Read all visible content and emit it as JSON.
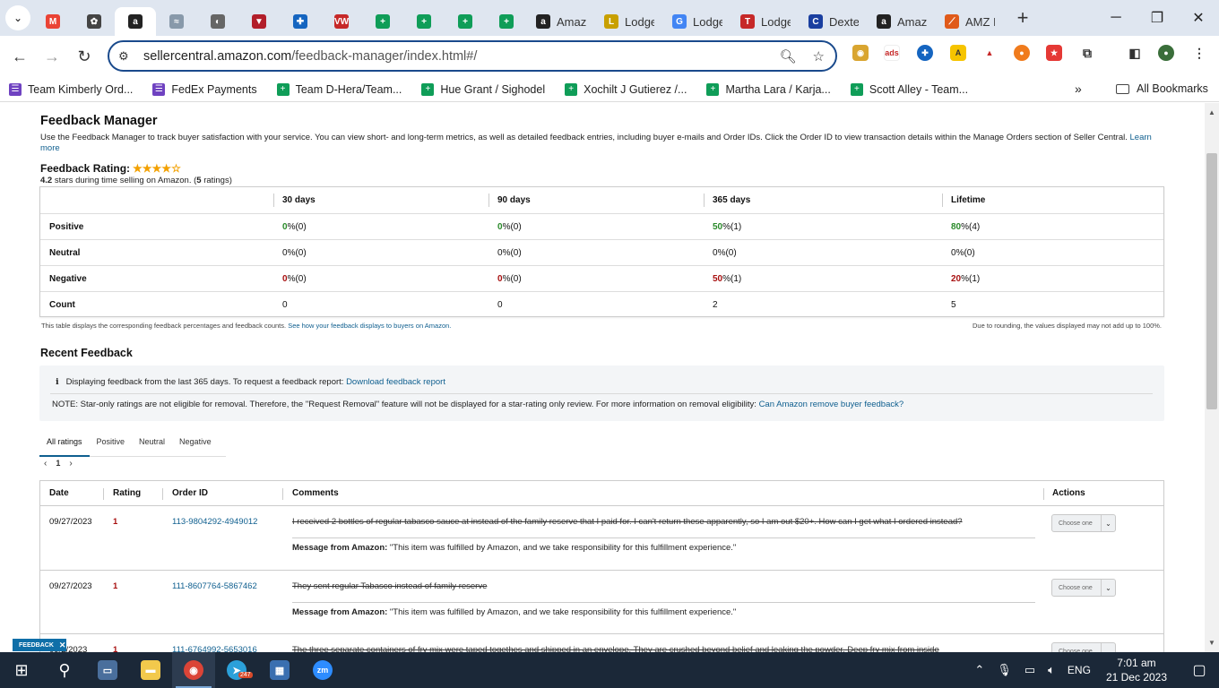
{
  "browser": {
    "tabs": [
      {
        "icon": "gmail-icon",
        "label": "",
        "color": "#ea4335",
        "glyph": "M"
      },
      {
        "icon": "chatgpt-icon",
        "label": "",
        "color": "#444444",
        "glyph": "✿"
      },
      {
        "icon": "amazon-icon",
        "label": "",
        "color": "#222222",
        "glyph": "a",
        "active": true
      },
      {
        "icon": "app-icon",
        "label": "",
        "color": "#8899aa",
        "glyph": "≈"
      },
      {
        "icon": "globe-icon",
        "label": "",
        "color": "#666666",
        "glyph": "◐"
      },
      {
        "icon": "shield-icon",
        "label": "",
        "color": "#b21e2a",
        "glyph": "▼"
      },
      {
        "icon": "compass-icon",
        "label": "",
        "color": "#1565c0",
        "glyph": "✚"
      },
      {
        "icon": "vw-icon",
        "label": "",
        "color": "#c62828",
        "glyph": "VW"
      },
      {
        "icon": "sheets-icon",
        "label": "",
        "color": "#0f9d58",
        "glyph": "+"
      },
      {
        "icon": "sheets-icon",
        "label": "",
        "color": "#0f9d58",
        "glyph": "+"
      },
      {
        "icon": "sheets-icon",
        "label": "",
        "color": "#0f9d58",
        "glyph": "+"
      },
      {
        "icon": "sheets-icon",
        "label": "",
        "color": "#0f9d58",
        "glyph": "+"
      },
      {
        "icon": "amazon-icon",
        "label": "Amaz",
        "color": "#222222",
        "glyph": "a"
      },
      {
        "icon": "lodge-icon",
        "label": "Lodge",
        "color": "#c8a000",
        "glyph": "L"
      },
      {
        "icon": "google-icon",
        "label": "Lodge",
        "color": "#4285f4",
        "glyph": "G"
      },
      {
        "icon": "tsc-icon",
        "label": "Lodge",
        "color": "#c62828",
        "glyph": "T"
      },
      {
        "icon": "dexter-icon",
        "label": "Dexte",
        "color": "#1a3fa0",
        "glyph": "C"
      },
      {
        "icon": "amazon-icon",
        "label": "Amaz",
        "color": "#222222",
        "glyph": "a"
      },
      {
        "icon": "amz-icon",
        "label": "AMZ I",
        "color": "#e05a1a",
        "glyph": "⟋"
      }
    ],
    "url_domain": "sellercentral.amazon.com",
    "url_path": "/feedback-manager/index.html#/",
    "bookmarks": [
      {
        "label": "Team Kimberly Ord...",
        "color": "#6f42c1"
      },
      {
        "label": "FedEx Payments",
        "color": "#6f42c1"
      },
      {
        "label": "Team D-Hera/Team...",
        "color": "#0f9d58"
      },
      {
        "label": "Hue Grant / Sighodel",
        "color": "#0f9d58"
      },
      {
        "label": "Xochilt J Gutierez /...",
        "color": "#0f9d58"
      },
      {
        "label": "Martha Lara / Karja...",
        "color": "#0f9d58"
      },
      {
        "label": "Scott Alley - Team...",
        "color": "#0f9d58"
      }
    ],
    "all_bookmarks": "All Bookmarks",
    "more_bookmarks": "»"
  },
  "page": {
    "title": "Feedback Manager",
    "intro": "Use the Feedback Manager to track buyer satisfaction with your service. You can view short- and long-term metrics, as well as detailed feedback entries, including buyer e-mails and Order IDs. Click the Order ID to view transaction details within the Manage Orders section of Seller Central.",
    "learn_more": "Learn more",
    "rating_label": "Feedback Rating:",
    "stars": "★★★★☆",
    "rating_value": "4.2",
    "rating_text_mid": " stars during time selling on Amazon. (",
    "rating_count": "5",
    "rating_text_end": " ratings)"
  },
  "metrics": {
    "columns": [
      "30 days",
      "90 days",
      "365 days",
      "Lifetime"
    ],
    "rows": [
      {
        "label": "Positive",
        "cells": [
          [
            "0",
            " %(0)",
            "green"
          ],
          [
            "0",
            " %(0)",
            "green"
          ],
          [
            "50",
            " %(1)",
            "green"
          ],
          [
            "80",
            " %(4)",
            "green"
          ]
        ]
      },
      {
        "label": "Neutral",
        "cells": [
          [
            "0",
            " %(0)",
            "plain"
          ],
          [
            "0",
            " %(0)",
            "plain"
          ],
          [
            "0",
            " %(0)",
            "plain"
          ],
          [
            "0",
            " %(0)",
            "plain"
          ]
        ]
      },
      {
        "label": "Negative",
        "cells": [
          [
            "0",
            " %(0)",
            "red"
          ],
          [
            "0",
            " %(0)",
            "red"
          ],
          [
            "50",
            " %(1)",
            "red"
          ],
          [
            "20",
            " %(1)",
            "red"
          ]
        ]
      },
      {
        "label": "Count",
        "cells": [
          [
            "0",
            "",
            "plain"
          ],
          [
            "0",
            "",
            "plain"
          ],
          [
            "2",
            "",
            "plain"
          ],
          [
            "5",
            "",
            "plain"
          ]
        ]
      }
    ],
    "footnote_left": "This table displays the corresponding feedback percentages and feedback counts.",
    "footnote_link": "See how your feedback displays to buyers on Amazon.",
    "footnote_right": "Due to rounding, the values displayed may not add up to 100%."
  },
  "recent": {
    "title": "Recent Feedback",
    "info_icon": "i",
    "info_text": "Displaying feedback from the last 365 days. To request a feedback report:",
    "info_link": "Download feedback report",
    "note_text": "NOTE: Star-only ratings are not eligible for removal. Therefore, the \"Request Removal\" feature will not be displayed for a star-rating only review. For more information on removal eligibility:",
    "note_link": "Can Amazon remove buyer feedback?",
    "filters": [
      "All ratings",
      "Positive",
      "Neutral",
      "Negative"
    ],
    "page": "1",
    "columns": [
      "Date",
      "Rating",
      "Order ID",
      "Comments",
      "Actions"
    ],
    "rows": [
      {
        "date": "09/27/2023",
        "rating": "1",
        "order": "113-9804292-4949012",
        "comment": "I received 2 bottles of regular tabasco sauce at instead of the family reserve that I paid for. I can't return these apparently, so I am out $20+. How can I get what I ordered instead?",
        "msg_label": "Message from Amazon:",
        "msg": " \"This item was fulfilled by Amazon, and we take responsibility for this fulfillment experience.\"",
        "action": "Choose one"
      },
      {
        "date": "09/27/2023",
        "rating": "1",
        "order": "111-8607764-5867462",
        "comment": "They sent regular Tabasco instead of family reserve",
        "msg_label": "Message from Amazon:",
        "msg": " \"This item was fulfilled by Amazon, and we take responsibility for this fulfillment experience.\"",
        "action": "Choose one"
      },
      {
        "date": "09/2/2023",
        "rating": "1",
        "order": "111-6764992-5653016",
        "comment": "The three separate containers of fry mix were taped togethes and shipped in an envelope. They are crushed beyond belief and leaking the powder. Deep fry mix from inside",
        "msg_label": "",
        "msg": "",
        "action": "Choose one"
      }
    ],
    "feedback_pill": "FEEDBACK"
  },
  "taskbar": {
    "telegram_badge": "247",
    "lang": "ENG",
    "time": "7:01 am",
    "date": "21 Dec 2023"
  }
}
